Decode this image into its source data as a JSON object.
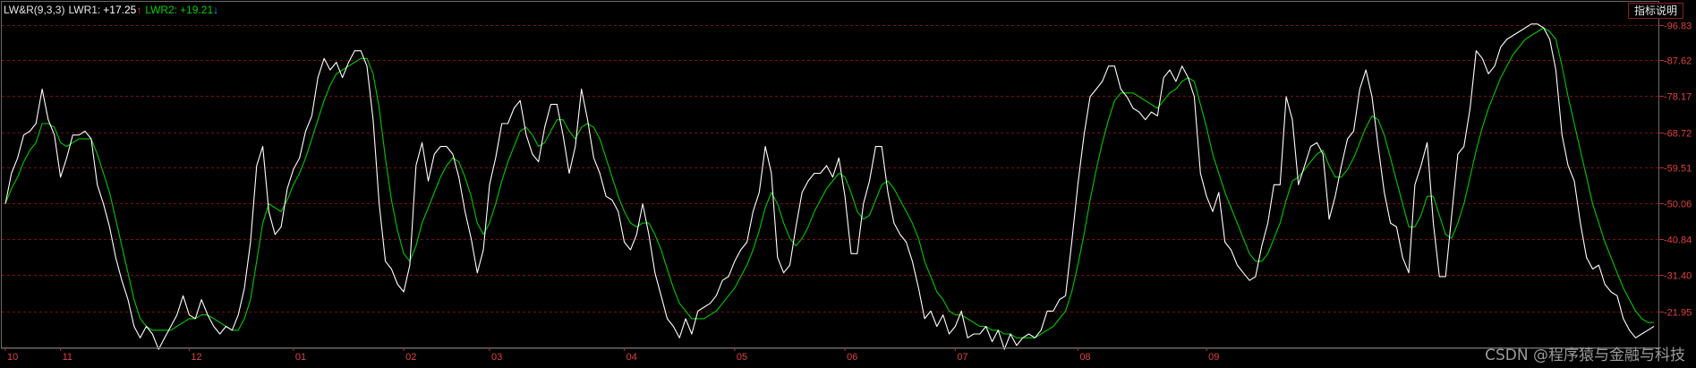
{
  "header": {
    "indicator": "LW&R(9,3,3)",
    "lwr1_label": "LWR1:",
    "lwr1_value": "+17.25",
    "lwr1_arrow": "↑",
    "lwr2_label": "LWR2:",
    "lwr2_value": "+19.21",
    "lwr2_arrow": "↓",
    "explain_button": "指标说明"
  },
  "watermark": "CSDN @程序猿与金融与科技",
  "colors": {
    "background": "#000000",
    "lwr1": "#ffffff",
    "lwr2": "#00c800",
    "grid": "#7a0f0f",
    "axis_text": "#e04040",
    "up_arrow": "#ff3030",
    "down_arrow": "#19b6ff"
  },
  "chart_data": {
    "type": "line",
    "ylim": [
      12.5,
      100
    ],
    "yticks": [
      "96.83",
      "87.62",
      "78.17",
      "68.72",
      "59.51",
      "50.06",
      "40.84",
      "31.40",
      "21.95"
    ],
    "ytick_values": [
      96.83,
      87.62,
      78.17,
      68.72,
      59.51,
      50.06,
      40.84,
      31.4,
      21.95
    ],
    "grid": true,
    "x_labels": [
      "10",
      "11",
      "12",
      "01",
      "02",
      "03",
      "04",
      "05",
      "06",
      "07",
      "08",
      "09"
    ],
    "x_label_index": [
      0,
      9,
      30,
      47,
      65,
      79,
      101,
      119,
      137,
      155,
      175,
      196
    ],
    "series": [
      {
        "name": "LWR1",
        "values": [
          50,
          58,
          62,
          68,
          69,
          71,
          80,
          72,
          68,
          57,
          62,
          68,
          68,
          69,
          67,
          55,
          50,
          44,
          36,
          30,
          25,
          18,
          15,
          18,
          16,
          12,
          15,
          18,
          21,
          26,
          21,
          20,
          25,
          21,
          18,
          16,
          18,
          17,
          21,
          28,
          40,
          60,
          65,
          48,
          42,
          44,
          54,
          59,
          62,
          69,
          73,
          83,
          88,
          85,
          87,
          83,
          87,
          90,
          90,
          86,
          72,
          50,
          35,
          33,
          29,
          27,
          34,
          60,
          66,
          56,
          63,
          65,
          65,
          63,
          57,
          48,
          41,
          32,
          38,
          55,
          62,
          71,
          71,
          75,
          77,
          68,
          63,
          61,
          70,
          76,
          76,
          68,
          58,
          65,
          80,
          72,
          62,
          58,
          52,
          51,
          48,
          40,
          38,
          42,
          50,
          42,
          32,
          26,
          20,
          18,
          15,
          20,
          16,
          22,
          23,
          24,
          26,
          30,
          31,
          35,
          38,
          40,
          48,
          53,
          65,
          58,
          36,
          32,
          34,
          44,
          53,
          56,
          58,
          58,
          60,
          57,
          62,
          52,
          37,
          37,
          50,
          56,
          65,
          65,
          53,
          45,
          42,
          40,
          35,
          28,
          20,
          22,
          18,
          21,
          16,
          18,
          22,
          15,
          16,
          16,
          18,
          14,
          17,
          12,
          16,
          13,
          15,
          16,
          15,
          17,
          22,
          22,
          25,
          26,
          40,
          55,
          68,
          78,
          80,
          82,
          86,
          86,
          80,
          78,
          75,
          74,
          72,
          74,
          73,
          83,
          85,
          82,
          86,
          83,
          78,
          58,
          52,
          48,
          53,
          40,
          38,
          34,
          32,
          30,
          31,
          39,
          45,
          55,
          55,
          78,
          72,
          55,
          60,
          65,
          66,
          63,
          46,
          52,
          60,
          67,
          69,
          80,
          85,
          78,
          65,
          53,
          45,
          44,
          36,
          32,
          55,
          60,
          66,
          45,
          31,
          31,
          47,
          63,
          65,
          75,
          90,
          88,
          84,
          86,
          91,
          93,
          94,
          95,
          96,
          97,
          97,
          96,
          93,
          85,
          68,
          60,
          56,
          45,
          36,
          33,
          34,
          29,
          27,
          26,
          20,
          17,
          15,
          16,
          17,
          18
        ]
      },
      {
        "name": "LWR2",
        "values": [
          50,
          54,
          57,
          61,
          64,
          66,
          71,
          71,
          70,
          66,
          65,
          66,
          67,
          67,
          67,
          63,
          58,
          53,
          46,
          39,
          32,
          25,
          20,
          18,
          17,
          17,
          17,
          17,
          18,
          19,
          20,
          20,
          21,
          21,
          20,
          19,
          18,
          17,
          17,
          20,
          25,
          35,
          45,
          50,
          49,
          48,
          51,
          55,
          58,
          62,
          67,
          72,
          77,
          81,
          84,
          85,
          86,
          87,
          88,
          88,
          84,
          75,
          62,
          51,
          43,
          37,
          35,
          39,
          45,
          49,
          53,
          57,
          60,
          62,
          61,
          57,
          52,
          45,
          42,
          45,
          50,
          56,
          61,
          65,
          69,
          70,
          68,
          65,
          66,
          69,
          72,
          72,
          69,
          67,
          70,
          71,
          70,
          67,
          62,
          57,
          52,
          48,
          45,
          44,
          45,
          45,
          42,
          38,
          33,
          28,
          24,
          22,
          20,
          20,
          20,
          21,
          22,
          24,
          26,
          28,
          31,
          34,
          38,
          43,
          49,
          53,
          50,
          45,
          41,
          39,
          41,
          44,
          48,
          51,
          54,
          56,
          58,
          57,
          53,
          48,
          46,
          47,
          51,
          55,
          56,
          54,
          51,
          48,
          45,
          41,
          35,
          31,
          27,
          25,
          22,
          21,
          21,
          20,
          19,
          18,
          18,
          17,
          17,
          16,
          16,
          15,
          15,
          15,
          15,
          16,
          17,
          18,
          20,
          22,
          27,
          34,
          42,
          51,
          59,
          66,
          72,
          77,
          79,
          79,
          79,
          78,
          77,
          76,
          75,
          77,
          79,
          80,
          82,
          83,
          82,
          76,
          70,
          63,
          58,
          53,
          49,
          45,
          41,
          37,
          35,
          35,
          37,
          41,
          45,
          51,
          56,
          57,
          59,
          61,
          63,
          64,
          60,
          57,
          57,
          59,
          62,
          66,
          70,
          73,
          72,
          68,
          62,
          56,
          50,
          44,
          44,
          47,
          52,
          52,
          47,
          42,
          41,
          45,
          50,
          57,
          64,
          70,
          75,
          79,
          83,
          86,
          89,
          91,
          93,
          94,
          95,
          96,
          95,
          93,
          86,
          78,
          71,
          64,
          57,
          50,
          45,
          40,
          36,
          32,
          28,
          25,
          22,
          20,
          19,
          19
        ]
      }
    ]
  }
}
